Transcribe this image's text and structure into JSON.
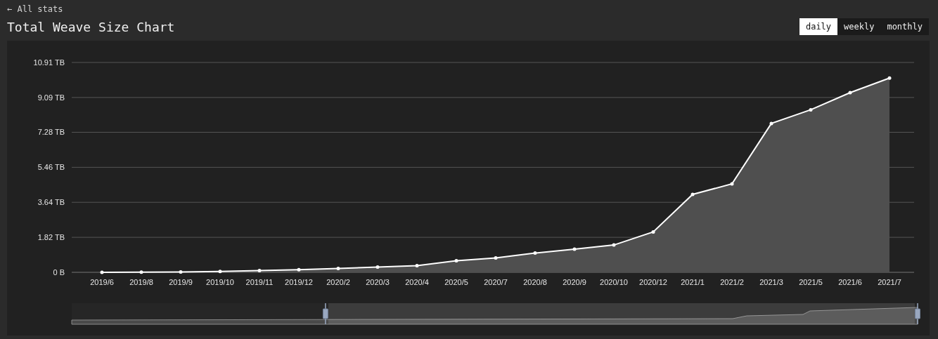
{
  "back_link": "← All stats",
  "title": "Total Weave Size Chart",
  "period_tabs": [
    {
      "label": "daily",
      "selected": true
    },
    {
      "label": "weekly",
      "selected": false
    },
    {
      "label": "monthly",
      "selected": false
    }
  ],
  "chart": {
    "chart_data": {
      "type": "area",
      "categories": [
        "2019/6",
        "2019/8",
        "2019/9",
        "2019/10",
        "2019/11",
        "2019/12",
        "2020/2",
        "2020/3",
        "2020/4",
        "2020/5",
        "2020/7",
        "2020/8",
        "2020/9",
        "2020/10",
        "2020/12",
        "2021/1",
        "2021/2",
        "2021/3",
        "2021/5",
        "2021/6",
        "2021/7"
      ],
      "grid": true,
      "series": [
        {
          "values": [
            0,
            0.01,
            0.02,
            0.05,
            0.09,
            0.14,
            0.2,
            0.27,
            0.35,
            0.6,
            0.75,
            1.0,
            1.2,
            1.42,
            2.1,
            4.05,
            4.6,
            7.74,
            8.45,
            9.34,
            10.1
          ]
        }
      ],
      "ylim": [
        0,
        10.91
      ],
      "yticks": [
        {
          "value": 0,
          "label": "0 B"
        },
        {
          "value": 1.82,
          "label": "1.82 TB"
        },
        {
          "value": 3.64,
          "label": "3.64 TB"
        },
        {
          "value": 5.46,
          "label": "5.46 TB"
        },
        {
          "value": 7.28,
          "label": "7.28 TB"
        },
        {
          "value": 9.09,
          "label": "9.09 TB"
        },
        {
          "value": 10.91,
          "label": "10.91 TB"
        }
      ]
    },
    "navigator": {
      "level": 0.7
    }
  }
}
